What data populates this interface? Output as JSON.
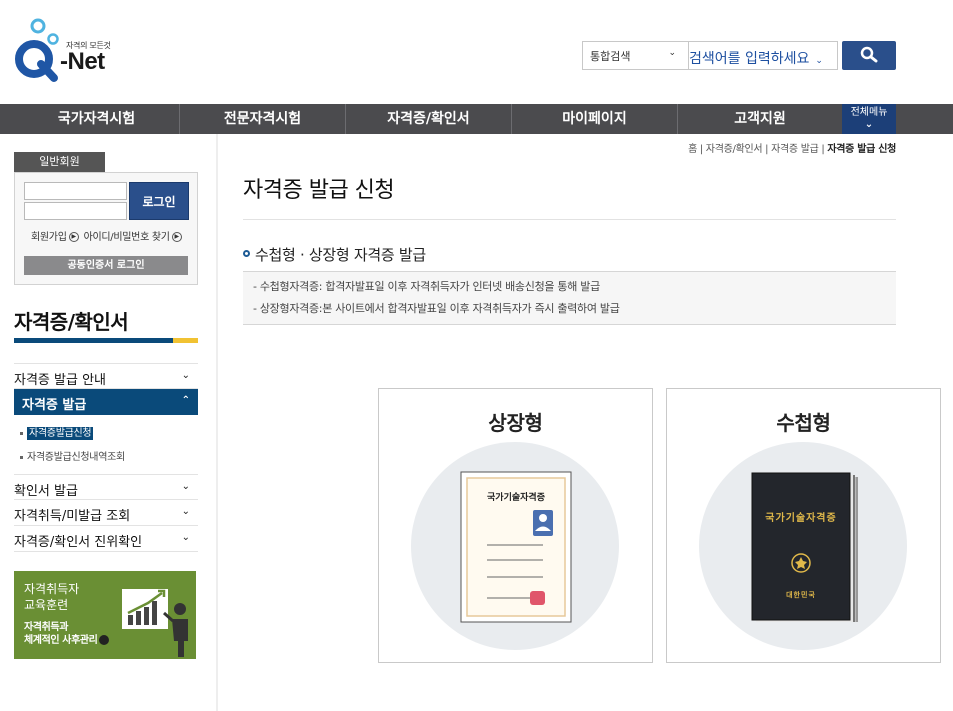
{
  "header": {
    "logo_tagline": "자격의 모든것",
    "logo_text": "Net",
    "search_scope": "통합검색",
    "search_placeholder": "검색어를 입력하세요"
  },
  "gnb": {
    "items": [
      "국가자격시험",
      "전문자격시험",
      "자격증/확인서",
      "마이페이지",
      "고객지원"
    ],
    "all_menu": "전체메뉴"
  },
  "login": {
    "tab": "일반회원",
    "button": "로그인",
    "join": "회원가입",
    "find": "아이디/비밀번호 찾기",
    "cert_login": "공동인증서 로그인"
  },
  "lnb": {
    "title": "자격증/확인서",
    "items": [
      "자격증 발급 안내",
      "자격증 발급",
      "확인서 발급",
      "자격취득/미발급 조회",
      "자격증/확인서 진위확인"
    ],
    "subitems": [
      "자격증발급신청",
      "자격증발급신청내역조회"
    ]
  },
  "banner": {
    "line1": "자격취득자",
    "line2": "교육훈련",
    "line3": "자격취득과",
    "line4": "체계적인 사후관리"
  },
  "breadcrumb": [
    "홈",
    "자격증/확인서",
    "자격증 발급",
    "자격증 발급 신청"
  ],
  "content": {
    "title": "자격증 발급 신청",
    "section_title": "수첩형 · 상장형 자격증 발급",
    "info": [
      "- 수첩형자격증: 합격자발표일 이후 자격취득자가 인터넷 배송신청을 통해 발급",
      "- 상장형자격증:본 사이트에서 합격자발표일 이후 자격취득자가 즉시 출력하여 발급"
    ]
  },
  "cards": [
    {
      "title": "상장형",
      "doc_title": "국가기술자격증"
    },
    {
      "title": "수첩형",
      "book_title": "국가기술자격증",
      "book_footer": "대한민국"
    }
  ],
  "colors": {
    "primary": "#2a4f8b",
    "nav_bg": "#4b4b4e",
    "lnb_active": "#0a4a7a",
    "accent_yellow": "#f1c232",
    "banner_green": "#6a8f34"
  }
}
